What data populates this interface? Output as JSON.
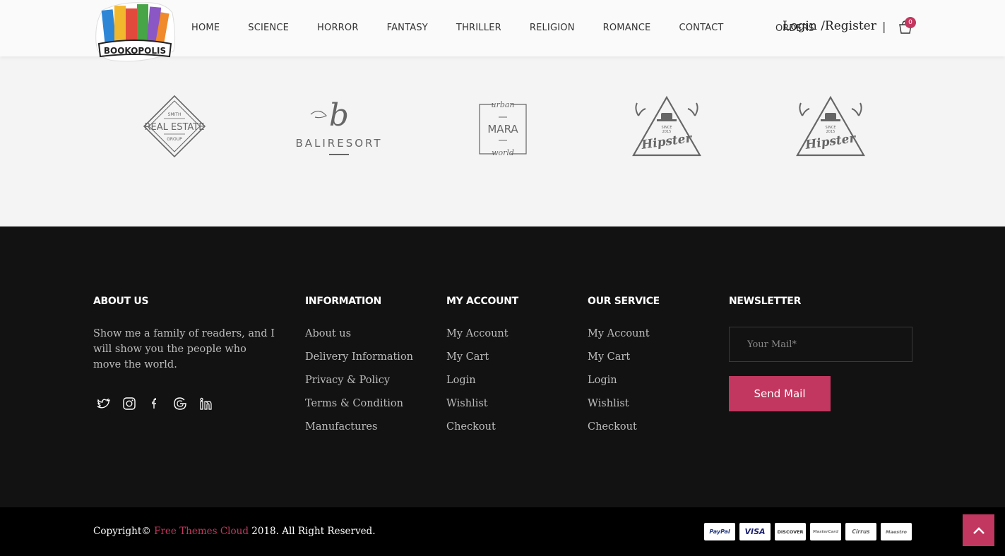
{
  "header": {
    "logo_text": "BOOKOPOLIS",
    "nav": [
      "HOME",
      "SCIENCE",
      "HORROR",
      "FANTASY",
      "THRILLER",
      "RELIGION",
      "ROMANCE",
      "CONTACT"
    ],
    "orders_label": "ORDERS",
    "login_label": "Login /Register",
    "separator": "|",
    "cart_count": "0",
    "accent_color": "#c2375f"
  },
  "brands": [
    {
      "icon": "real-estate-logo",
      "lines": [
        "SMITH",
        "REAL ESTATE",
        "GROUP"
      ]
    },
    {
      "icon": "bali-resort-logo",
      "lines": [
        "b",
        "BALIRESORT"
      ]
    },
    {
      "icon": "mara-logo",
      "lines": [
        "urban",
        "MARA",
        "world"
      ]
    },
    {
      "icon": "hipster-logo",
      "lines": [
        "SINCE",
        "2015",
        "Hipster"
      ]
    },
    {
      "icon": "hipster-logo",
      "lines": [
        "SINCE",
        "2015",
        "Hipster"
      ]
    }
  ],
  "footer": {
    "about": {
      "title": "ABOUT US",
      "text": "Show me a family of readers, and I will show you the people who move the world.",
      "social": [
        "twitter-icon",
        "instagram-icon",
        "facebook-icon",
        "google-icon",
        "linkedin-icon"
      ]
    },
    "information": {
      "title": "INFORMATION",
      "links": [
        "About us",
        "Delivery Information",
        "Privacy & Policy",
        "Terms & Condition",
        "Manufactures"
      ]
    },
    "my_account": {
      "title": "MY ACCOUNT",
      "links": [
        "My Account",
        "My Cart",
        "Login",
        "Wishlist",
        "Checkout"
      ]
    },
    "our_service": {
      "title": "OUR SERVICE",
      "links": [
        "My Account",
        "My Cart",
        "Login",
        "Wishlist",
        "Checkout"
      ]
    },
    "newsletter": {
      "title": "NEWSLETTER",
      "placeholder": "Your Mail*",
      "button": "Send Mail"
    }
  },
  "bottom": {
    "copyright_prefix": "Copyright©",
    "copyright_link": "Free Themes Cloud",
    "copyright_suffix": "2018. All Right Reserved.",
    "payments": [
      "PayPal",
      "VISA",
      "DISCOVER",
      "MasterCard",
      "Cirrus",
      "Maestro"
    ]
  }
}
